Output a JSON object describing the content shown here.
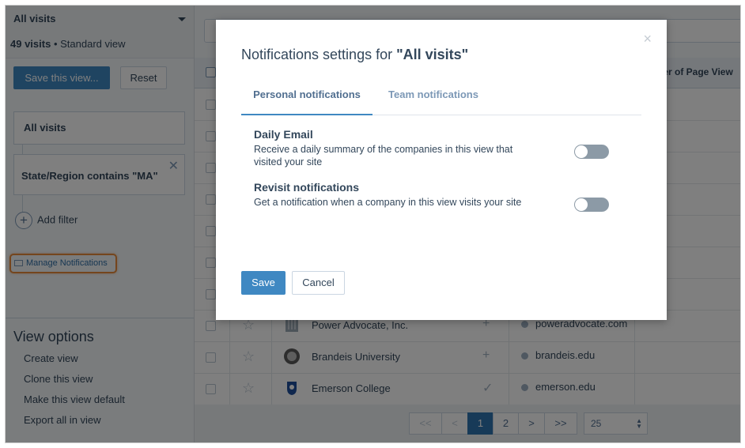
{
  "sidebar": {
    "view_name": "All visits",
    "visit_count": "49 visits",
    "view_type": "• Standard view",
    "save_view_label": "Save this view...",
    "reset_label": "Reset",
    "filters": [
      {
        "label": "All visits"
      },
      {
        "label": "State/Region contains \"MA\""
      }
    ],
    "filter_close_glyph": "✕",
    "add_filter_label": "Add filter",
    "manage_notifications_label": "Manage Notifications",
    "view_options": {
      "title": "View options",
      "items": [
        "Create view",
        "Clone this view",
        "Make this view default",
        "Export all in view"
      ]
    }
  },
  "table": {
    "partial_column_header": "ber of Page View",
    "rows": [
      {
        "company": "Power Advocate, Inc.",
        "mark": "+",
        "domain": "poweradvocate.com"
      },
      {
        "company": "Brandeis University",
        "mark": "+",
        "domain": "brandeis.edu"
      },
      {
        "company": "Emerson College",
        "mark": "✓",
        "domain": "emerson.edu"
      }
    ],
    "pagination": {
      "first": "<<",
      "prev": "<",
      "pages": [
        "1",
        "2"
      ],
      "current_page": "1",
      "next": ">",
      "last": ">>",
      "per_page": "25"
    }
  },
  "modal": {
    "title_prefix": "Notifications settings for ",
    "title_view": "\"All visits\"",
    "close_glyph": "×",
    "tabs": [
      {
        "label": "Personal notifications",
        "active": true
      },
      {
        "label": "Team notifications",
        "active": false
      }
    ],
    "settings": [
      {
        "title": "Daily Email",
        "description": "Receive a daily summary of the companies in this view that visited your site",
        "enabled": false
      },
      {
        "title": "Revisit notifications",
        "description": "Get a notification when a company in this view visits your site",
        "enabled": false
      }
    ],
    "save_label": "Save",
    "cancel_label": "Cancel"
  },
  "colors": {
    "primary": "#3f88c2",
    "highlight_outline": "#e98a3a",
    "toggle_off": "#8c9aa6",
    "text": "#33475b"
  },
  "icons": [
    "caret-down-icon",
    "close-icon",
    "plus-circle-icon",
    "envelope-icon",
    "star-icon",
    "globe-icon"
  ]
}
